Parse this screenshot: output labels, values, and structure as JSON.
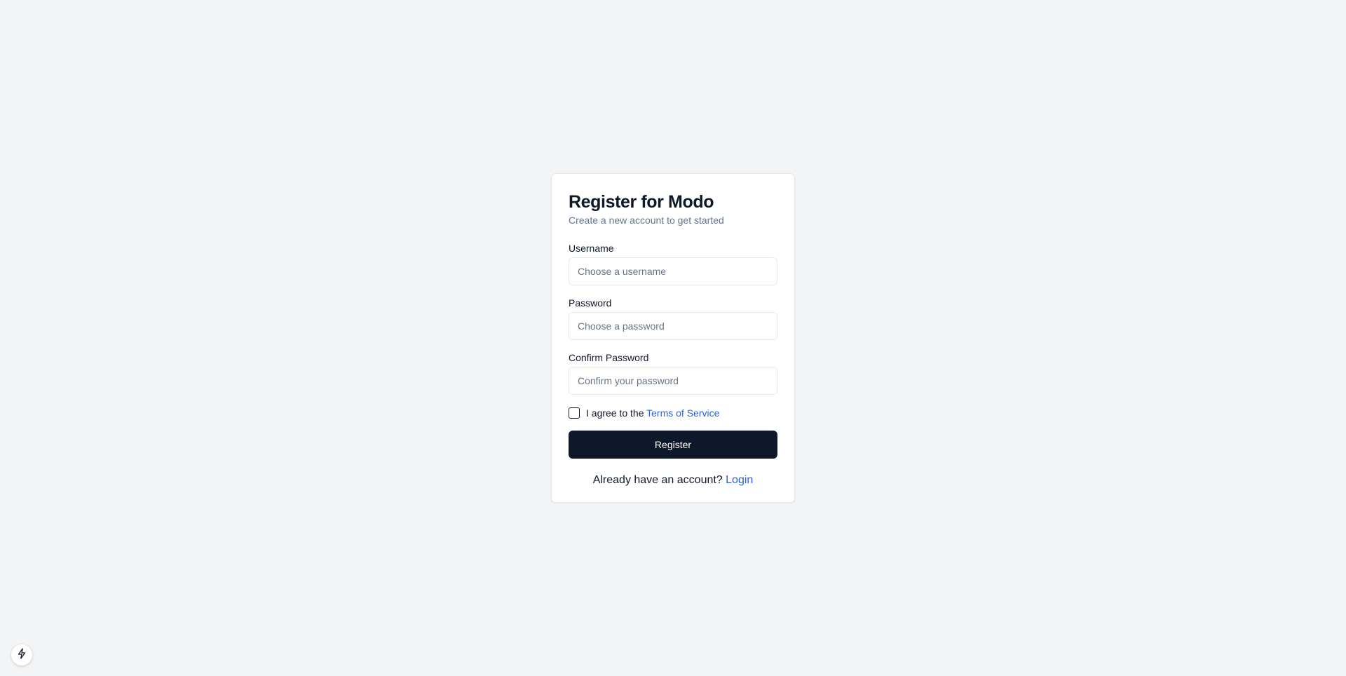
{
  "header": {
    "title": "Register for Modo",
    "subtitle": "Create a new account to get started"
  },
  "form": {
    "username": {
      "label": "Username",
      "placeholder": "Choose a username",
      "value": ""
    },
    "password": {
      "label": "Password",
      "placeholder": "Choose a password",
      "value": ""
    },
    "confirm_password": {
      "label": "Confirm Password",
      "placeholder": "Confirm your password",
      "value": ""
    },
    "terms": {
      "checked": false,
      "prefix": "I agree to the ",
      "link_label": "Terms of Service"
    },
    "submit_label": "Register"
  },
  "footer": {
    "question": "Already have an account? ",
    "login_label": "Login"
  },
  "corner_badge": {
    "icon": "lightning-icon"
  },
  "colors": {
    "background": "#f3f4f6",
    "card": "#ffffff",
    "primary": "#0f172a",
    "link": "#2563eb",
    "muted": "#64748b"
  }
}
